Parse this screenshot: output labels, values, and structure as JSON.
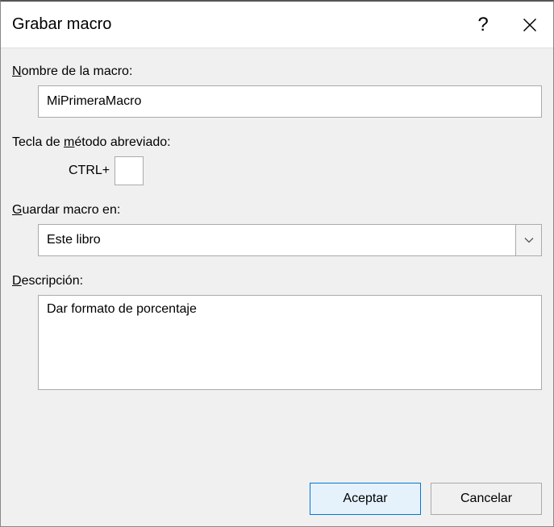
{
  "titlebar": {
    "title": "Grabar macro",
    "help": "?",
    "close_icon": "×"
  },
  "labels": {
    "name_prefix": "N",
    "name_rest": "ombre de la macro:",
    "shortcut_prefix_text": "Tecla de ",
    "shortcut_underline": "m",
    "shortcut_rest": "étodo abreviado:",
    "store_prefix": "G",
    "store_rest": "uardar macro en:",
    "desc_prefix": "D",
    "desc_rest": "escripción:"
  },
  "fields": {
    "macro_name": "MiPrimeraMacro",
    "shortcut_prefix_label": "CTRL+",
    "shortcut_key": "",
    "store_in": "Este libro",
    "description": "Dar formato de porcentaje"
  },
  "buttons": {
    "accept": "Aceptar",
    "cancel": "Cancelar"
  }
}
